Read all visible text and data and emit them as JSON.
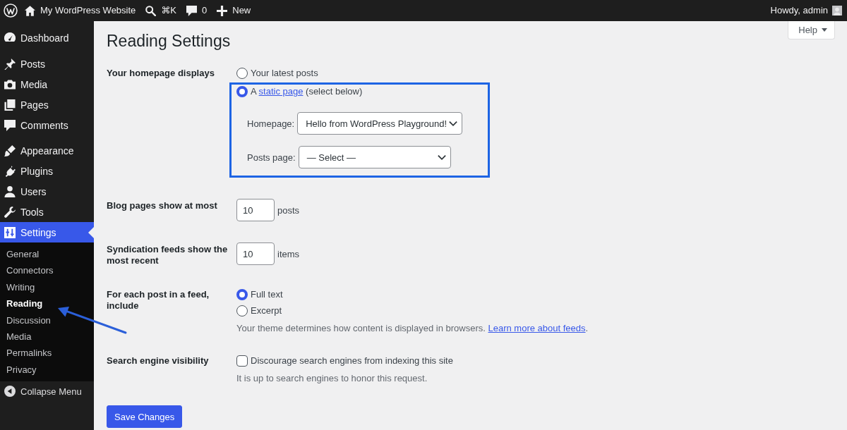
{
  "admin_bar": {
    "items": [
      {
        "kind": "logo"
      },
      {
        "kind": "home",
        "label": "My WordPress Website"
      },
      {
        "kind": "search",
        "label": "⌘K"
      },
      {
        "kind": "comments",
        "label": "0"
      },
      {
        "kind": "new",
        "label": "New"
      }
    ],
    "account": {
      "label": "Howdy, admin"
    }
  },
  "sidebar": {
    "groups": [
      {
        "items": [
          {
            "kind": "dashboard",
            "label": "Dashboard",
            "selected": false
          }
        ]
      },
      {
        "items": [
          {
            "kind": "posts",
            "label": "Posts",
            "selected": false
          },
          {
            "kind": "media",
            "label": "Media",
            "selected": false
          },
          {
            "kind": "pages",
            "label": "Pages",
            "selected": false
          },
          {
            "kind": "comments",
            "label": "Comments",
            "selected": false
          }
        ]
      },
      {
        "items": [
          {
            "kind": "appearance",
            "label": "Appearance",
            "selected": false
          },
          {
            "kind": "plugins",
            "label": "Plugins",
            "selected": false
          },
          {
            "kind": "users",
            "label": "Users",
            "selected": false
          },
          {
            "kind": "tools",
            "label": "Tools",
            "selected": false
          },
          {
            "kind": "settings",
            "label": "Settings",
            "selected": true,
            "children": [
              {
                "label": "General",
                "selected": false,
                "highlighted": false
              },
              {
                "label": "Connectors",
                "selected": false,
                "highlighted": false
              },
              {
                "label": "Writing",
                "selected": false,
                "highlighted": false
              },
              {
                "label": "Reading",
                "selected": true,
                "highlighted": true
              },
              {
                "label": "Discussion",
                "selected": false,
                "highlighted": false
              },
              {
                "label": "Media",
                "selected": false,
                "highlighted": false
              },
              {
                "label": "Permalinks",
                "selected": false,
                "highlighted": false
              },
              {
                "label": "Privacy",
                "selected": false,
                "highlighted": false
              }
            ]
          }
        ]
      }
    ],
    "collapse": {
      "label": "Collapse Menu"
    }
  },
  "page": {
    "title": "Reading Settings",
    "help": "Help"
  },
  "settings": [
    {
      "kind": "radios",
      "label": "Your homepage displays",
      "options": [
        {
          "segments": [
            {
              "kind": "text",
              "text": "Your latest posts"
            }
          ],
          "selected": false,
          "highlighted": false
        },
        {
          "segments": [
            {
              "kind": "text",
              "text": "A "
            },
            {
              "kind": "link",
              "text": "static page"
            },
            {
              "kind": "text",
              "text": " (select below)"
            }
          ],
          "selected": true,
          "highlighted": true,
          "selects": [
            {
              "label": "Homepage:",
              "value": "Hello from WordPress Playground!"
            },
            {
              "label": "Posts page:",
              "value": "— Select —"
            }
          ]
        }
      ]
    },
    {
      "kind": "number",
      "label": "Blog pages show at most",
      "value": "10",
      "unit": "posts"
    },
    {
      "kind": "number",
      "label": "Syndication feeds show the most recent",
      "value": "10",
      "unit": "items"
    },
    {
      "kind": "radios",
      "label": "For each post in a feed, include",
      "options": [
        {
          "segments": [
            {
              "kind": "text",
              "text": "Full text"
            }
          ],
          "selected": true
        },
        {
          "segments": [
            {
              "kind": "text",
              "text": "Excerpt"
            }
          ],
          "selected": false
        }
      ],
      "description": [
        {
          "kind": "text",
          "text": "Your theme determines how content is displayed in browsers. "
        },
        {
          "kind": "link",
          "text": "Learn more about feeds"
        },
        {
          "kind": "text",
          "text": "."
        }
      ]
    },
    {
      "kind": "checkbox",
      "label": "Search engine visibility",
      "text": "Discourage search engines from indexing this site",
      "checked": false,
      "description": [
        {
          "kind": "text",
          "text": "It is up to search engines to honor this request."
        }
      ]
    }
  ],
  "save_button": "Save Changes"
}
